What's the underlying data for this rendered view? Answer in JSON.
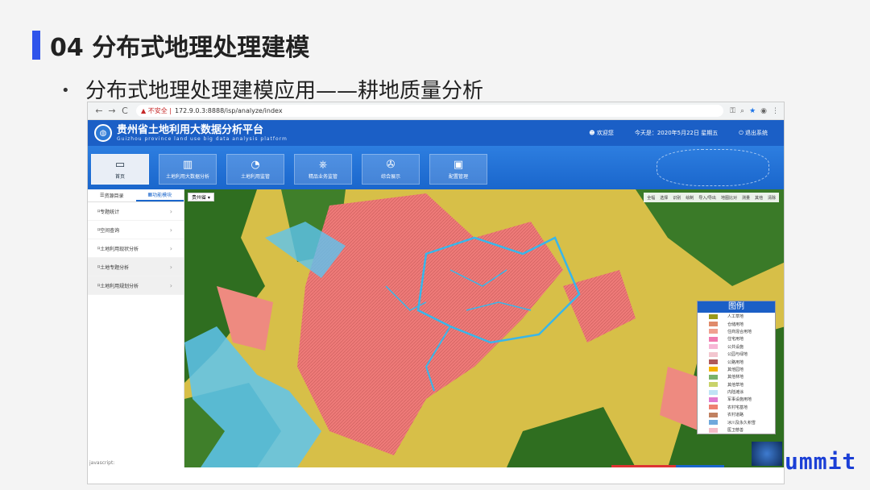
{
  "slide": {
    "title": "04 分布式地理处理建模",
    "bullet": "•",
    "subtitle": "分布式地理处理建模应用——耕地质量分析",
    "brand": "ummit"
  },
  "browser": {
    "back": "←",
    "forward": "→",
    "reload": "C",
    "warning": "▲ 不安全 |",
    "url": "172.9.0.3:8888/isp/analyze/index"
  },
  "app": {
    "title": "贵州省土地利用大数据分析平台",
    "subtitle": "Guizhou province land use big data analysis platform",
    "welcome": "欢迎您",
    "date": "今天是：2020年5月22日 星期五",
    "logout": "退出系统",
    "nav": [
      "首页",
      "土地利用大数据分析",
      "土地利用监管",
      "精品业务监管",
      "综合展示",
      "配置管理"
    ],
    "side_tabs": [
      "资源目录",
      "功能模块"
    ],
    "side_items": [
      "专题统计",
      "空间查询",
      "土地利用现状分析",
      "土地专题分析",
      "土地利用规划分析"
    ],
    "status": "javascript:",
    "region": "贵州省 ▾",
    "toolbar": [
      "全幅",
      "选择",
      "识别",
      "绘制",
      "导入/导出",
      "地图比对",
      "测量",
      "其他",
      "清除"
    ]
  },
  "legend": {
    "title": "图例",
    "items": [
      {
        "label": "人工草地",
        "color": "#9a9a1a"
      },
      {
        "label": "仓储用地",
        "color": "#e08a6a"
      },
      {
        "label": "住商混合用地",
        "color": "#f0a090"
      },
      {
        "label": "住宅用地",
        "color": "#f07ab0"
      },
      {
        "label": "公共设施",
        "color": "#f7b7d6"
      },
      {
        "label": "公园与绿地",
        "color": "#f3c6cf"
      },
      {
        "label": "公路用地",
        "color": "#b05a5a"
      },
      {
        "label": "其他园地",
        "color": "#f4b400"
      },
      {
        "label": "其他林地",
        "color": "#79b26b"
      },
      {
        "label": "其他草地",
        "color": "#c9d36a"
      },
      {
        "label": "内陆滩涂",
        "color": "#bfe3f5"
      },
      {
        "label": "军事设施用地",
        "color": "#e07ad0"
      },
      {
        "label": "农村宅基地",
        "color": "#ee8070"
      },
      {
        "label": "农村道路",
        "color": "#c08060"
      },
      {
        "label": "冰川及永久积雪",
        "color": "#6fa8dc"
      },
      {
        "label": "医卫慈善",
        "color": "#f4bcc8"
      }
    ]
  },
  "colors": {
    "header": "#1b5fc6",
    "accent": "#2f54eb",
    "urban": "#ee7a78",
    "forest": "#2e6b1e",
    "water": "#4fc0ee",
    "farmland": "#d9c04a"
  }
}
